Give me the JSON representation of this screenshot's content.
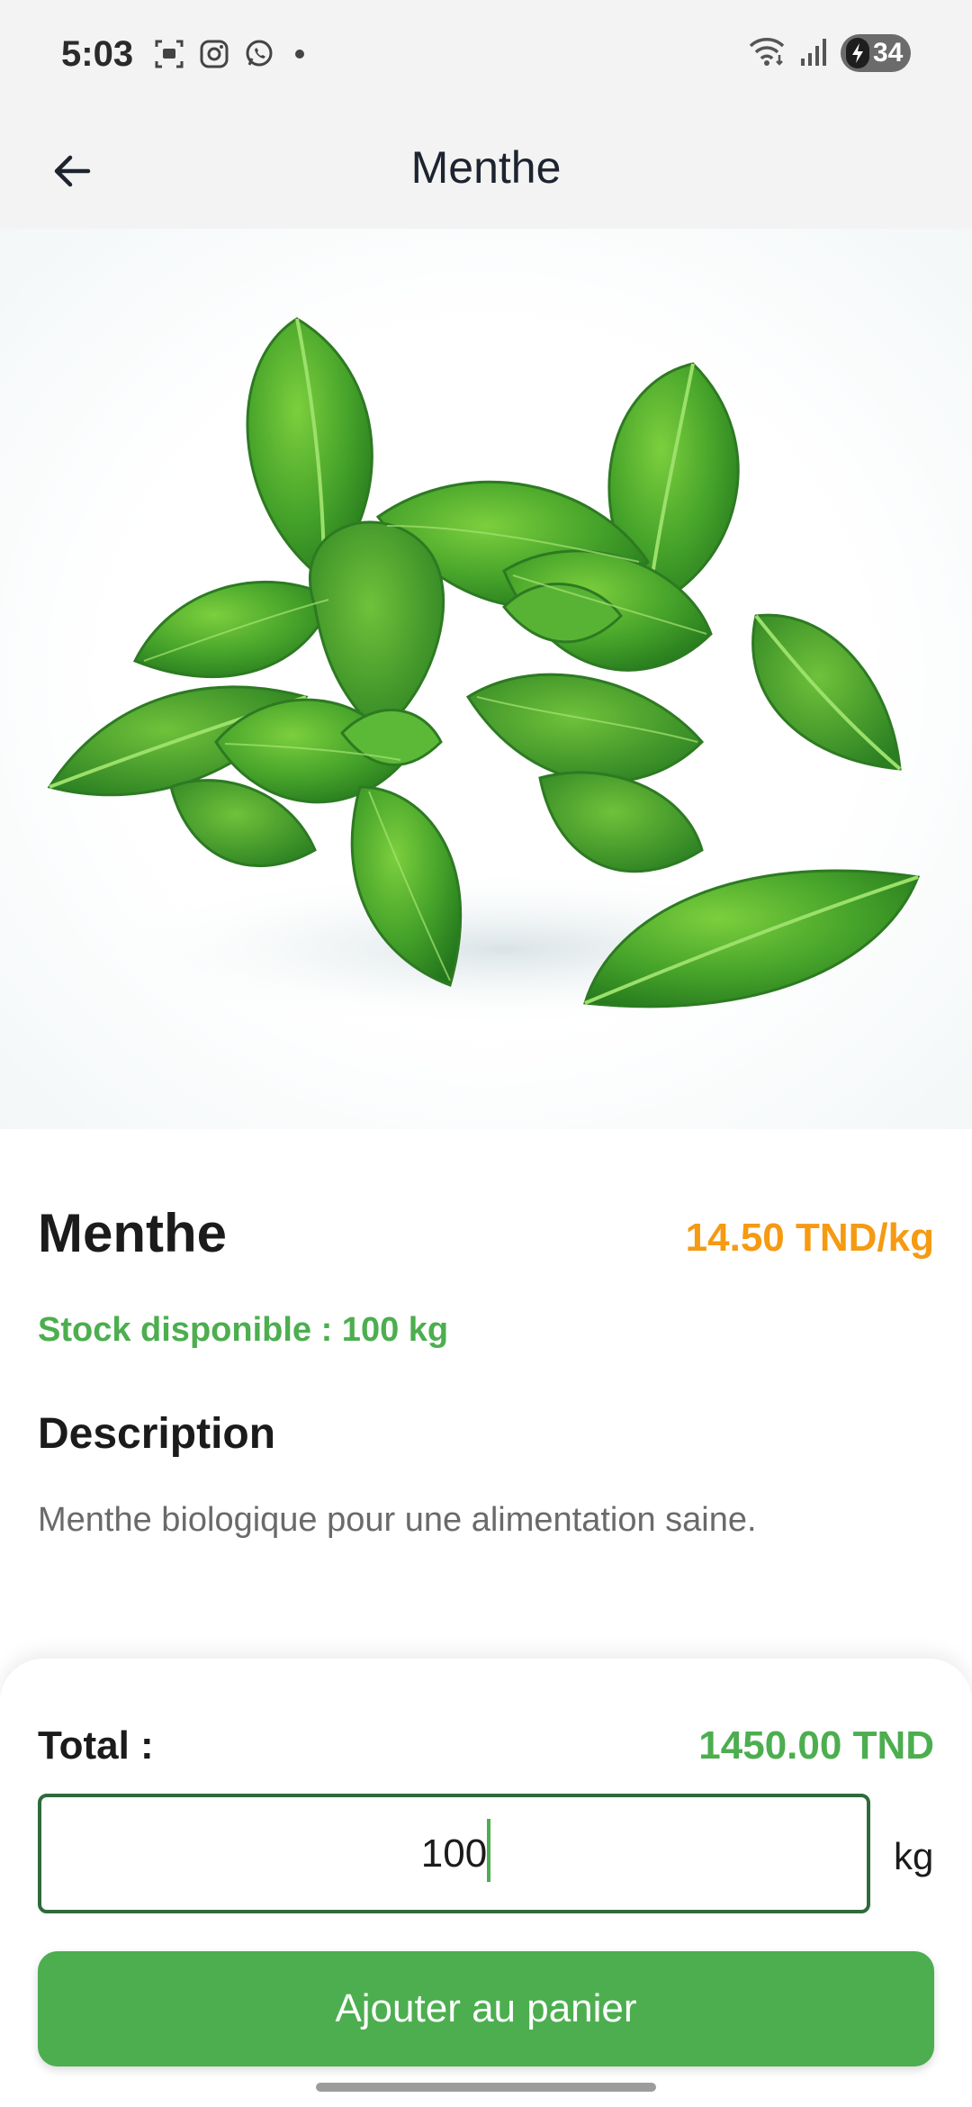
{
  "status_bar": {
    "time": "5:03",
    "battery": "34",
    "icons": [
      "screenshot-icon",
      "instagram-icon",
      "whatsapp-icon",
      "wifi-icon",
      "signal-icon",
      "battery-icon"
    ]
  },
  "app_bar": {
    "title": "Menthe",
    "back_icon": "arrow-left-icon"
  },
  "product": {
    "image_alt": "mint leaves",
    "name": "Menthe",
    "price": "14.50 TND/kg",
    "stock": "Stock disponible : 100 kg",
    "description_title": "Description",
    "description": "Menthe biologique pour une alimentation saine."
  },
  "order": {
    "total_label": "Total :",
    "total_value": "1450.00 TND",
    "quantity": "100",
    "unit": "kg",
    "add_button": "Ajouter au panier"
  },
  "colors": {
    "accent_green": "#4cae4f",
    "price_orange": "#f59a12",
    "input_border": "#2e6b3c"
  }
}
